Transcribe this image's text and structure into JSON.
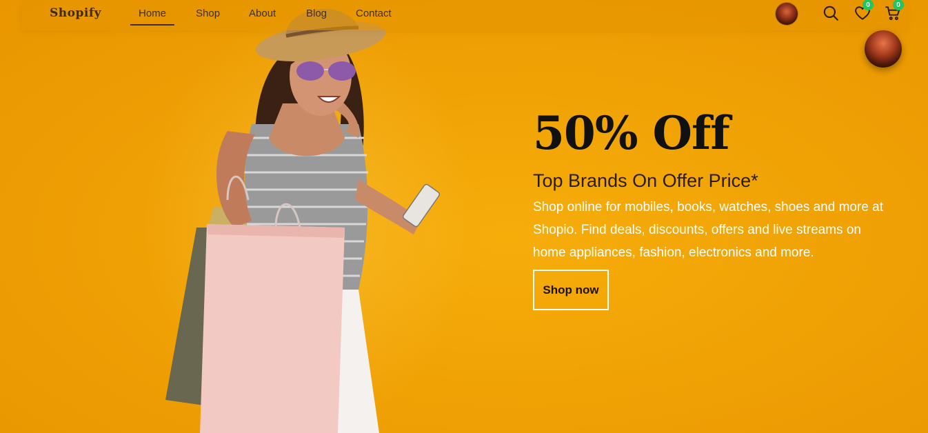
{
  "header": {
    "brand": "Shopify",
    "nav": [
      {
        "label": "Home",
        "active": true
      },
      {
        "label": "Shop",
        "active": false
      },
      {
        "label": "About",
        "active": false
      },
      {
        "label": "Blog",
        "active": false
      },
      {
        "label": "Contact",
        "active": false
      }
    ],
    "icons": [
      "avatar",
      "search-icon",
      "heart-icon",
      "cart-icon"
    ],
    "wishlist_count": "0",
    "cart_count": "0"
  },
  "hero": {
    "headline": "50% Off",
    "subheadline": "Top Brands On Offer Price*",
    "description": "Shop online for mobiles, books, watches, shoes and more at Shopio. Find deals, discounts, offers and live streams on home appliances, fashion, electronics and more.",
    "cta_label": "Shop now"
  },
  "colors": {
    "background": "#f0a205",
    "badge": "#22c55e",
    "headline": "#111111",
    "description": "#ffffff"
  }
}
